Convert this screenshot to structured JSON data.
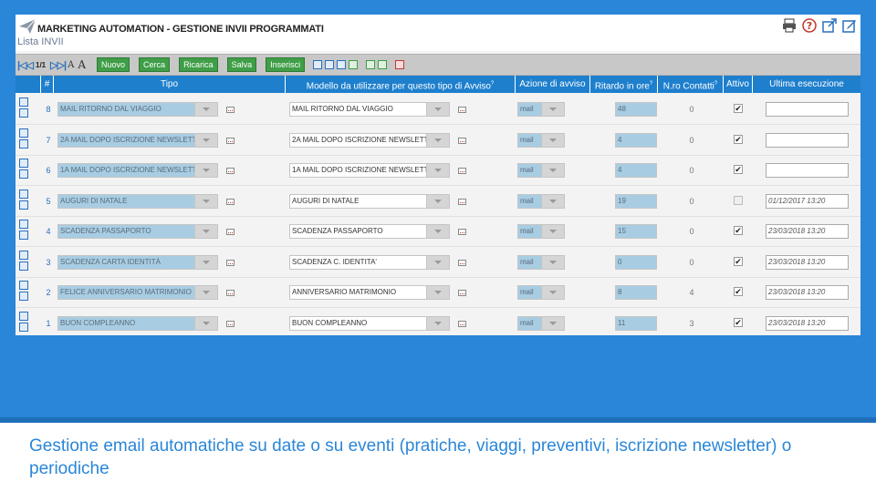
{
  "app": {
    "title": "MARKETING AUTOMATION - GESTIONE INVII PROGRAMMATI",
    "subtitle": "Lista INVII"
  },
  "toolbar": {
    "nav_first": "|◁◁",
    "nav_next": "▷▷|",
    "page": "1/1",
    "font_small": "A",
    "font_large": "A",
    "buttons": [
      "Nuovo",
      "Cerca",
      "Ricarica",
      "Salva",
      "Inserisci"
    ]
  },
  "table": {
    "headers": {
      "num": "#",
      "tipo": "Tipo",
      "modello": "Modello da utilizzare per questo tipo di Avviso",
      "azione": "Azione di avviso",
      "ritardo": "Ritardo in ore",
      "contatti": "N.ro Contatti",
      "attivo": "Attivo",
      "ultima": "Ultima esecuzione"
    },
    "header_marks": {
      "modello": "?",
      "ritardo": "?",
      "contatti": "?"
    },
    "rows": [
      {
        "num": "8",
        "tipo": "MAIL RITORNO DAL VIAGGIO",
        "modello": "MAIL RITORNO DAL VIAGGIO",
        "azione": "mail",
        "ritardo": "48",
        "contatti": "0",
        "attivo": true,
        "ultima": ""
      },
      {
        "num": "7",
        "tipo": "2A MAIL DOPO ISCRIZIONE NEWSLETTER",
        "modello": "2A MAIL DOPO ISCRIZIONE NEWSLETTER",
        "azione": "mail",
        "ritardo": "4",
        "contatti": "0",
        "attivo": true,
        "ultima": ""
      },
      {
        "num": "6",
        "tipo": "1A MAIL DOPO ISCRIZIONE NEWSLETTER",
        "modello": "1A MAIL DOPO ISCRIZIONE NEWSLETTER",
        "azione": "mail",
        "ritardo": "4",
        "contatti": "0",
        "attivo": true,
        "ultima": ""
      },
      {
        "num": "5",
        "tipo": "AUGURI DI NATALE",
        "modello": "AUGURI DI NATALE",
        "azione": "mail",
        "ritardo": "19",
        "contatti": "0",
        "attivo": false,
        "ultima": "01/12/2017 13:20"
      },
      {
        "num": "4",
        "tipo": "SCADENZA PASSAPORTO",
        "modello": "SCADENZA PASSAPORTO",
        "azione": "mail",
        "ritardo": "15",
        "contatti": "0",
        "attivo": true,
        "ultima": "23/03/2018 13:20"
      },
      {
        "num": "3",
        "tipo": "SCADENZA CARTA IDENTITÀ",
        "modello": "SCADENZA C. IDENTITA'",
        "azione": "mail",
        "ritardo": "0",
        "contatti": "0",
        "attivo": true,
        "ultima": "23/03/2018 13:20"
      },
      {
        "num": "2",
        "tipo": "FELICE ANNIVERSARIO MATRIMONIO",
        "modello": "ANNIVERSARIO MATRIMONIO",
        "azione": "mail",
        "ritardo": "8",
        "contatti": "4",
        "attivo": true,
        "ultima": "23/03/2018 13:20"
      },
      {
        "num": "1",
        "tipo": "BUON COMPLEANNO",
        "modello": "BUON COMPLEANNO",
        "azione": "mail",
        "ritardo": "11",
        "contatti": "3",
        "attivo": true,
        "ultima": "23/03/2018 13:20"
      }
    ]
  },
  "caption": "Gestione email automatiche su date o su eventi (pratiche, viaggi, preventivi, iscrizione newsletter) o periodiche",
  "colors": {
    "slide_blue": "#2a86d8",
    "header_blue": "#1e7fcd",
    "button_green": "#3f9e47",
    "readonly_field": "#a8cde3"
  }
}
